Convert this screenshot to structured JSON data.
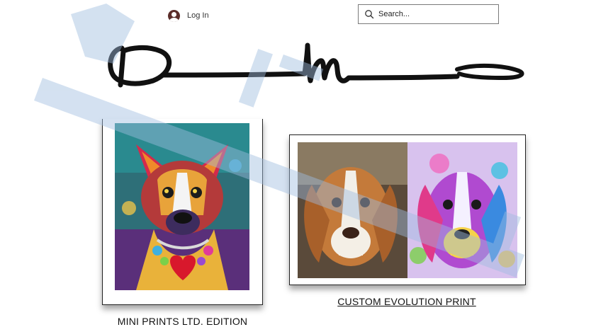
{
  "header": {
    "login_label": "Log In",
    "search_placeholder": "Search..."
  },
  "products": [
    {
      "caption": "MINI PRINTS LTD. EDITION"
    },
    {
      "caption": "CUSTOM EVOLUTION PRINT"
    }
  ],
  "colors": {
    "avatar": "#5b2d2a",
    "watermark": "#9fbde0",
    "frame_border": "#222222"
  },
  "icons": [
    "user-avatar-icon",
    "search-icon",
    "signature-logo"
  ]
}
